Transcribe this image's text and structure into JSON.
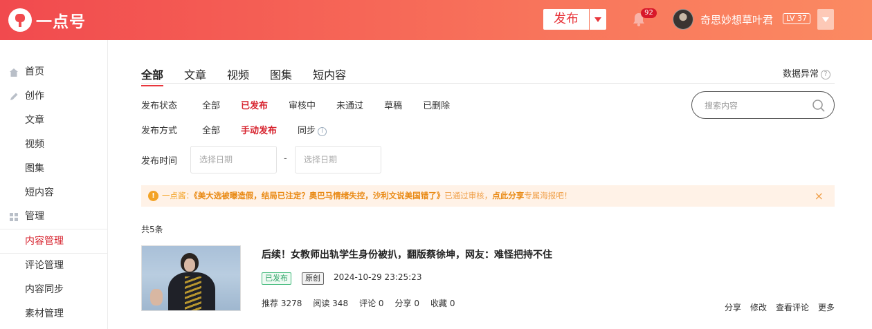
{
  "header": {
    "logo_text": "一点号",
    "publish_label": "发布",
    "notification_count": "92",
    "username": "奇思妙想草叶君",
    "level": "LV 37"
  },
  "sidebar": {
    "items": [
      {
        "label": "首页",
        "icon": "home-icon"
      },
      {
        "label": "创作",
        "icon": "pen-icon"
      },
      {
        "label": "文章"
      },
      {
        "label": "视频"
      },
      {
        "label": "图集"
      },
      {
        "label": "短内容"
      },
      {
        "label": "管理",
        "icon": "grid-icon"
      },
      {
        "label": "内容管理",
        "active": true
      },
      {
        "label": "评论管理"
      },
      {
        "label": "内容同步"
      },
      {
        "label": "素材管理"
      }
    ]
  },
  "main": {
    "tabs": [
      {
        "label": "全部",
        "active": true
      },
      {
        "label": "文章"
      },
      {
        "label": "视频"
      },
      {
        "label": "图集"
      },
      {
        "label": "短内容"
      }
    ],
    "data_anomaly_label": "数据异常",
    "status_filter": {
      "label": "发布状态",
      "options": [
        "全部",
        "已发布",
        "审核中",
        "未通过",
        "草稿",
        "已删除"
      ],
      "selected": "已发布"
    },
    "method_filter": {
      "label": "发布方式",
      "options": [
        "全部",
        "手动发布",
        "同步"
      ],
      "selected": "手动发布"
    },
    "search": {
      "placeholder": "搜索内容",
      "value": ""
    },
    "time_filter": {
      "label": "发布时间",
      "start_placeholder": "选择日期",
      "separator": "-",
      "end_placeholder": "选择日期"
    },
    "notice": {
      "prefix": "一点酱：",
      "title": "《美大选被曝造假，结局已注定？奥巴马情绪失控，沙利文说美国错了》",
      "middle": "已通过审核，",
      "cta": "点此分享",
      "tail": "专属海报吧！",
      "close": "×"
    },
    "total_label": "共5条",
    "articles": [
      {
        "title": "后续！女教师出轨学生身份被扒，翻版蔡徐坤，网友：难怪把持不住",
        "status": "已发布",
        "original": "原创",
        "time": "2024-10-29 23:25:23",
        "stats": {
          "recommend": "推荐 3278",
          "read": "阅读 348",
          "comment": "评论 0",
          "share": "分享 0",
          "favorite": "收藏 0"
        },
        "actions": [
          "分享",
          "修改",
          "查看评论",
          "更多"
        ]
      }
    ]
  },
  "colors": {
    "brand": "#e8363c",
    "active_text": "#d7232e",
    "notice_bg": "#fff2e7",
    "published_green": "#2ea567"
  }
}
